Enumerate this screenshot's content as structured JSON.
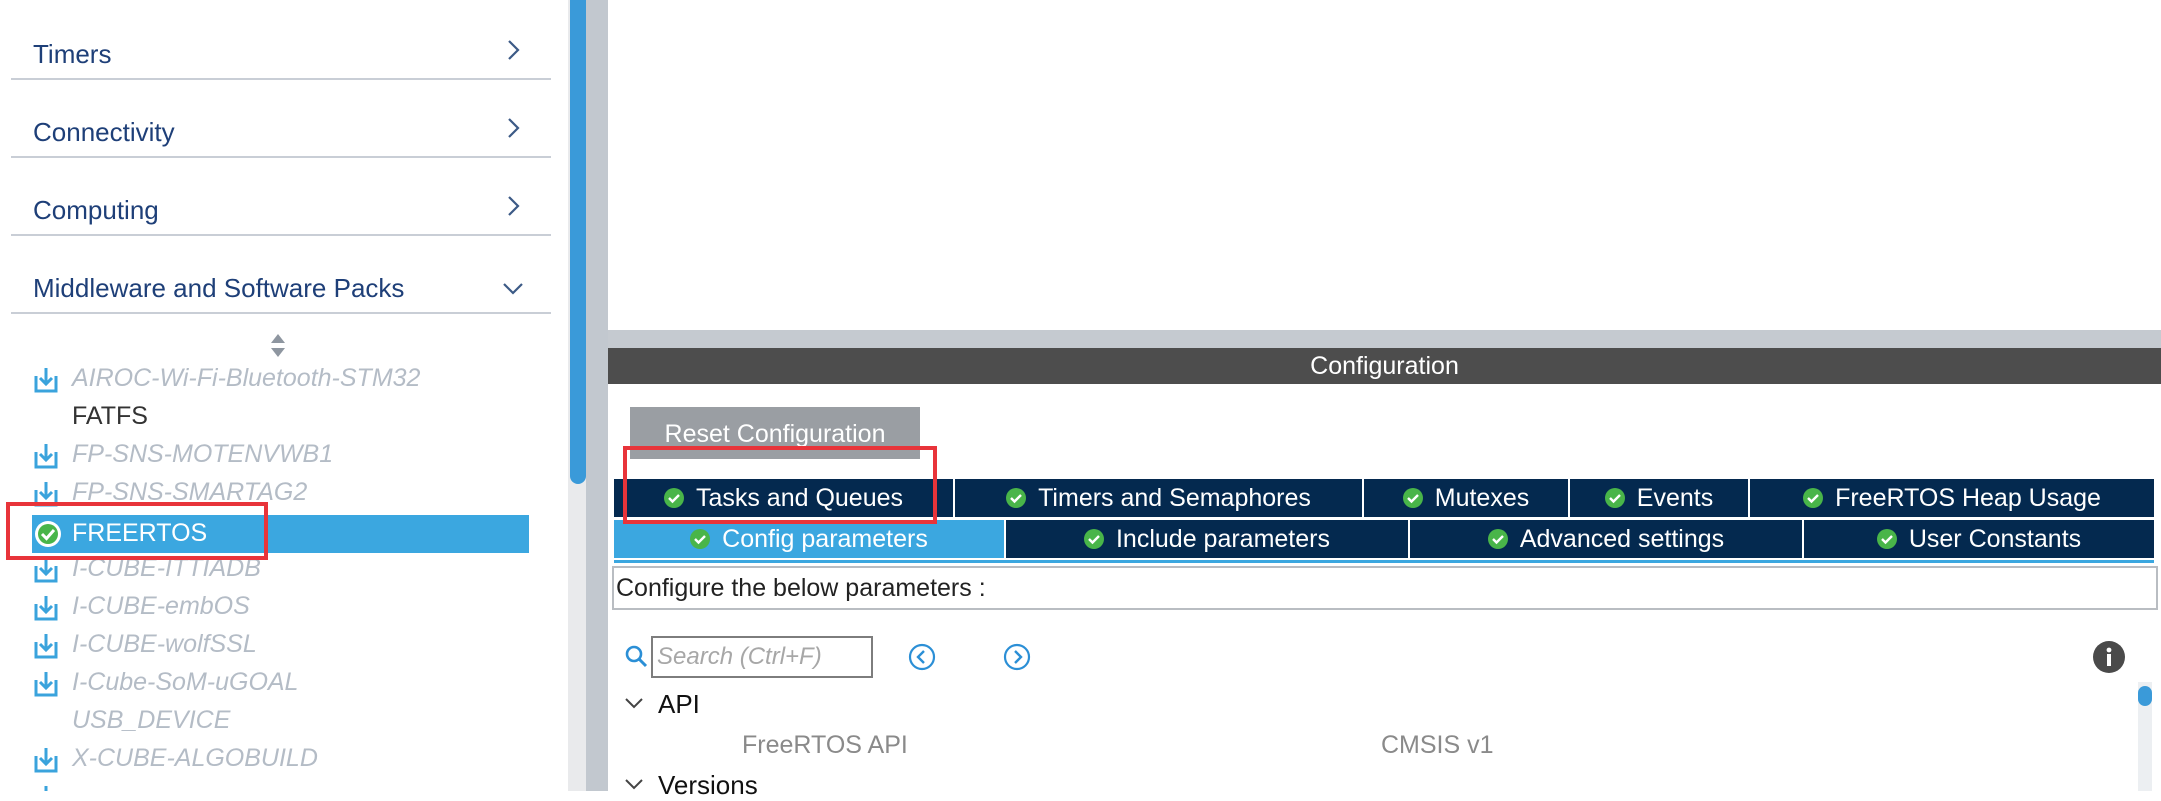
{
  "sidebar": {
    "categories": [
      {
        "label": "Timers",
        "expanded": false
      },
      {
        "label": "Connectivity",
        "expanded": false
      },
      {
        "label": "Computing",
        "expanded": false
      },
      {
        "label": "Middleware and Software Packs",
        "expanded": true
      }
    ],
    "packages": [
      {
        "label": "AIROC-Wi-Fi-Bluetooth-STM32",
        "icon": "download-icon",
        "state": "available"
      },
      {
        "label": "FATFS",
        "icon": "",
        "state": "plain"
      },
      {
        "label": "FP-SNS-MOTENVWB1",
        "icon": "download-icon",
        "state": "available"
      },
      {
        "label": "FP-SNS-SMARTAG2",
        "icon": "download-icon",
        "state": "available"
      },
      {
        "label": "FREERTOS",
        "icon": "check-circle-icon",
        "state": "selected"
      },
      {
        "label": "I-CUBE-ITTIADB",
        "icon": "download-icon",
        "state": "available"
      },
      {
        "label": "I-CUBE-embOS",
        "icon": "download-icon",
        "state": "available"
      },
      {
        "label": "I-CUBE-wolfSSL",
        "icon": "download-icon",
        "state": "available"
      },
      {
        "label": "I-Cube-SoM-uGOAL",
        "icon": "download-icon",
        "state": "available"
      },
      {
        "label": "USB_DEVICE",
        "icon": "",
        "state": "plain"
      },
      {
        "label": "X-CUBE-ALGOBUILD",
        "icon": "download-icon",
        "state": "available"
      }
    ]
  },
  "config": {
    "header": "Configuration",
    "reset_label": "Reset Configuration",
    "tabs_row1": [
      {
        "label": "Tasks and Queues"
      },
      {
        "label": "Timers and Semaphores"
      },
      {
        "label": "Mutexes"
      },
      {
        "label": "Events"
      },
      {
        "label": "FreeRTOS Heap Usage"
      }
    ],
    "tabs_row2": [
      {
        "label": "Config parameters",
        "active": true
      },
      {
        "label": "Include parameters"
      },
      {
        "label": "Advanced settings"
      },
      {
        "label": "User Constants"
      }
    ],
    "description": "Configure the below parameters :",
    "search_placeholder": "Search (Ctrl+F)",
    "groups": [
      {
        "label": "API",
        "params": [
          {
            "name": "FreeRTOS API",
            "value": "CMSIS v1"
          }
        ]
      },
      {
        "label": "Versions"
      }
    ]
  },
  "colors": {
    "accent": "#3ba7e0",
    "tab_dark": "#04294f",
    "highlight_box": "#e8343a",
    "header_bg": "#4d4d4d"
  }
}
